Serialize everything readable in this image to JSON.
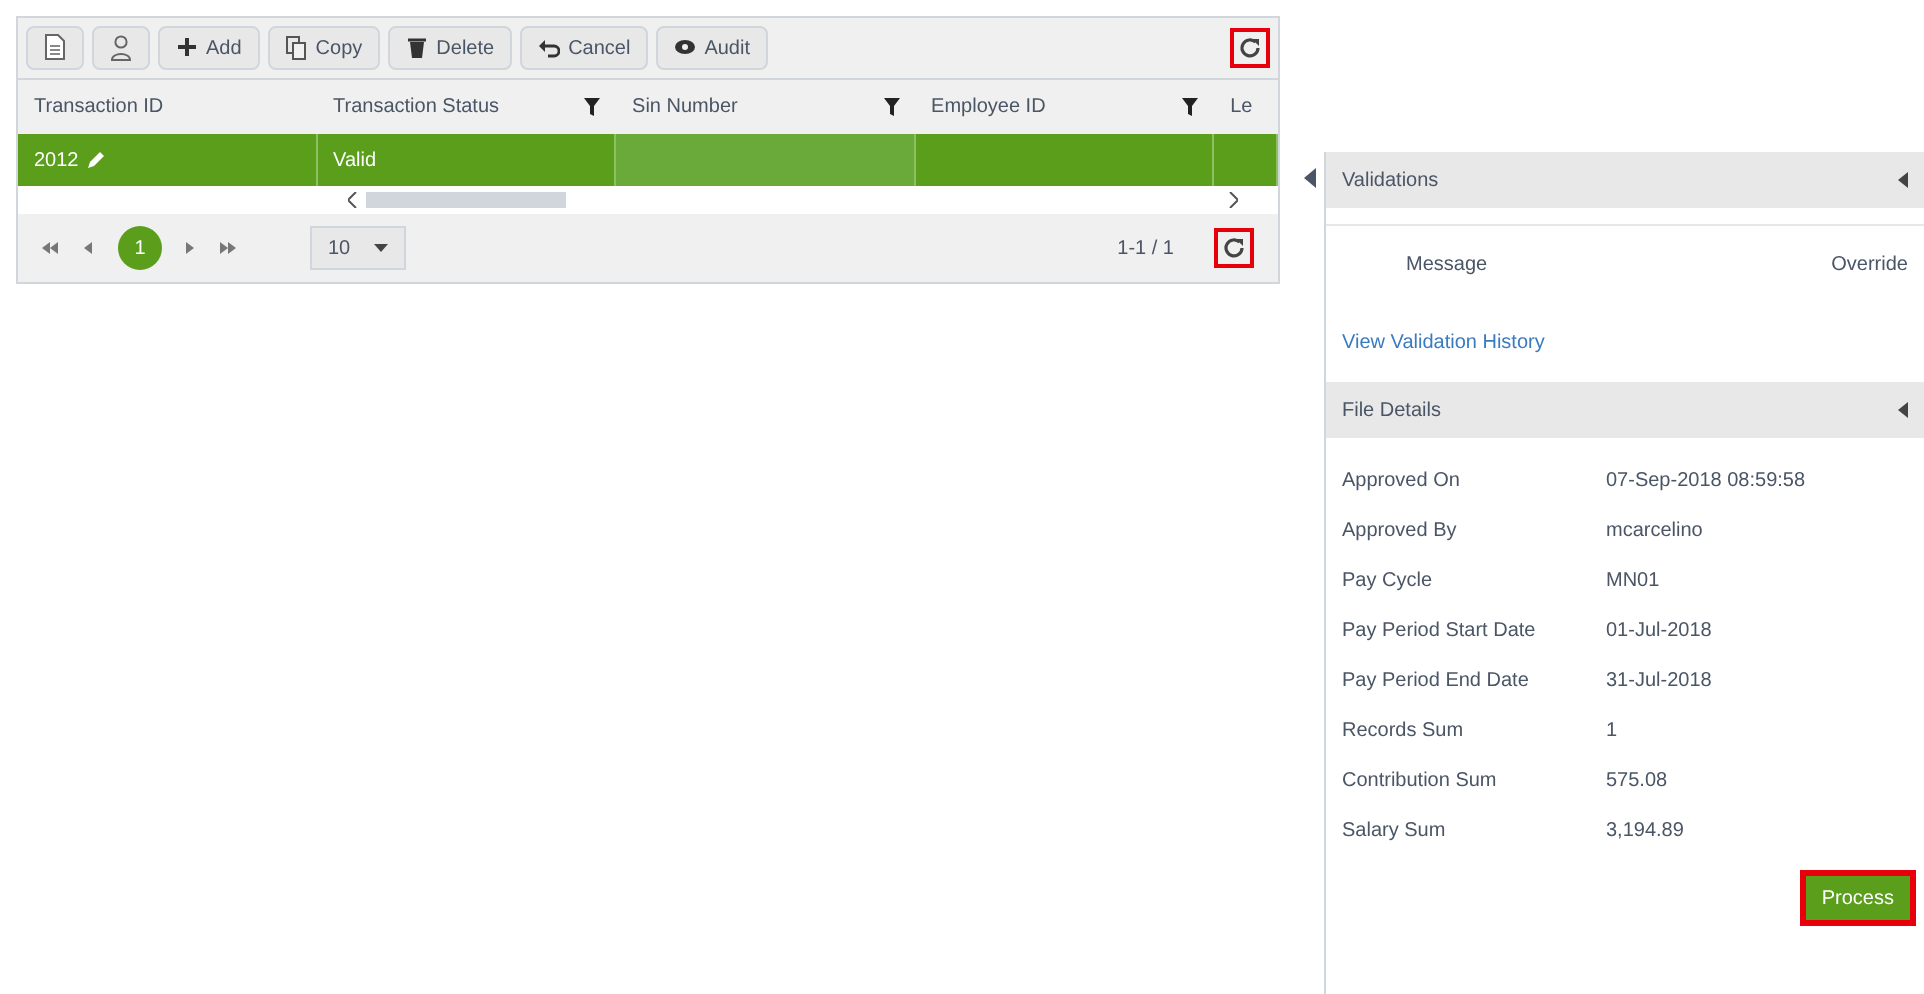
{
  "toolbar": {
    "buttons": [
      {
        "kind": "doc"
      },
      {
        "kind": "person"
      },
      {
        "kind": "add",
        "label": "Add"
      },
      {
        "kind": "copy",
        "label": "Copy"
      },
      {
        "kind": "delete",
        "label": "Delete"
      },
      {
        "kind": "cancel",
        "label": "Cancel"
      },
      {
        "kind": "audit",
        "label": "Audit"
      }
    ],
    "refresh_highlighted": true
  },
  "table": {
    "columns": [
      {
        "label": "Transaction ID",
        "filter": false
      },
      {
        "label": "Transaction Status",
        "filter": true
      },
      {
        "label": "Sin Number",
        "filter": true
      },
      {
        "label": "Employee ID",
        "filter": true
      },
      {
        "label": "Le",
        "filter": false
      }
    ],
    "rows": [
      {
        "cells": [
          "2012",
          "Valid",
          "",
          "",
          ""
        ],
        "selected": true
      }
    ]
  },
  "pager": {
    "pages": [
      {
        "label": "1",
        "selected": true
      }
    ],
    "page_size": "10",
    "summary": "1-1 / 1",
    "refresh_highlighted": true
  },
  "validations": {
    "title": "Validations",
    "columns": [
      "Message",
      "Override"
    ],
    "link": "View Validation History"
  },
  "file_details": {
    "title": "File Details",
    "fields": [
      {
        "label": "Approved On",
        "value": "07-Sep-2018 08:59:58"
      },
      {
        "label": "Approved By",
        "value": "mcarcelino"
      },
      {
        "label": "Pay Cycle",
        "value": "MN01"
      },
      {
        "label": "Pay Period Start Date",
        "value": "01-Jul-2018"
      },
      {
        "label": "Pay Period End Date",
        "value": "31-Jul-2018"
      },
      {
        "label": "Records Sum",
        "value": "1"
      },
      {
        "label": "Contribution Sum",
        "value": "575.08"
      },
      {
        "label": "Salary Sum",
        "value": "3,194.89"
      }
    ]
  },
  "process_button": {
    "label": "Process",
    "highlighted": true
  }
}
